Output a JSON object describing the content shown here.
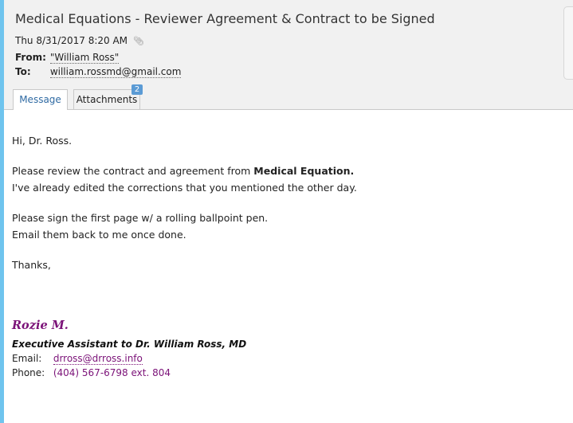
{
  "email": {
    "subject": "Medical Equations - Reviewer Agreement & Contract to be Signed",
    "date": "Thu 8/31/2017 8:20 AM",
    "attachment_icon": "paperclip-icon",
    "from_label": "From:",
    "from_value": "\"William Ross\"",
    "to_label": "To:",
    "to_value": "william.rossmd@gmail.com"
  },
  "tabs": {
    "message": "Message",
    "attachments": "Attachments",
    "attachments_count": "2"
  },
  "body": {
    "greeting": "Hi, Dr. Ross.",
    "para1_prefix": "Please review the contract and agreement from ",
    "para1_bold": "Medical Equation.",
    "para1_line2": "I've already edited the corrections that you mentioned the other day.",
    "para2_line1": "Please sign the first page w/ a rolling ballpoint pen.",
    "para2_line2": "Email them back to me once done.",
    "closing": "Thanks,"
  },
  "signature": {
    "name": "Rozie M.",
    "title": "Executive Assistant to Dr. William Ross, MD",
    "email_label": "Email:",
    "email_value": "drross@drross.info",
    "phone_label": "Phone:",
    "phone_value": "(404) 567-6798 ext. 804"
  },
  "colors": {
    "accent_bar": "#6fc4ee",
    "signature_purple": "#7b1278",
    "active_tab_text": "#2f6aa3",
    "badge": "#5b9bd5"
  }
}
